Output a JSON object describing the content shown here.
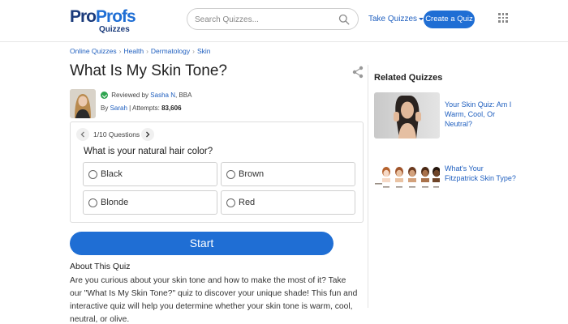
{
  "header": {
    "logo_main_1": "Pro",
    "logo_main_2": "Profs",
    "logo_sub": "Quizzes",
    "search_placeholder": "Search Quizzes...",
    "take_quizzes": "Take Quizzes",
    "create_quiz": "Create a Quiz"
  },
  "breadcrumb": [
    "Online Quizzes",
    "Health",
    "Dermatology",
    "Skin"
  ],
  "page": {
    "title": "What Is My Skin Tone?"
  },
  "author": {
    "reviewed_by_label": "Reviewed by",
    "reviewer": "Sasha N",
    "reviewer_suffix": ", BBA",
    "by_label": "By",
    "author_name": "Sarah",
    "attempts_label": "| Attempts:",
    "attempts": "83,606"
  },
  "quiz": {
    "counter": "1/10 Questions",
    "question": "What is your natural hair color?",
    "options": [
      "Black",
      "Brown",
      "Blonde",
      "Red"
    ],
    "start_label": "Start"
  },
  "about": {
    "title": "About This Quiz",
    "text": "Are you curious about your skin tone and how to make the most of it? Take our \"What Is My Skin Tone?\" quiz to discover your unique shade! This fun and interactive quiz will help you determine whether your skin tone is warm, cool, neutral, or olive."
  },
  "related": {
    "title": "Related Quizzes",
    "items": [
      {
        "label": "Your Skin Quiz: Am I Warm, Cool, Or Neutral?"
      },
      {
        "label": "What's Your Fitzpatrick Skin Type?"
      }
    ]
  },
  "colors": {
    "brand_blue": "#1f6ed4",
    "brand_navy": "#1a3a7a",
    "link_blue": "#1f5fbf",
    "check_green": "#2ea44f"
  }
}
